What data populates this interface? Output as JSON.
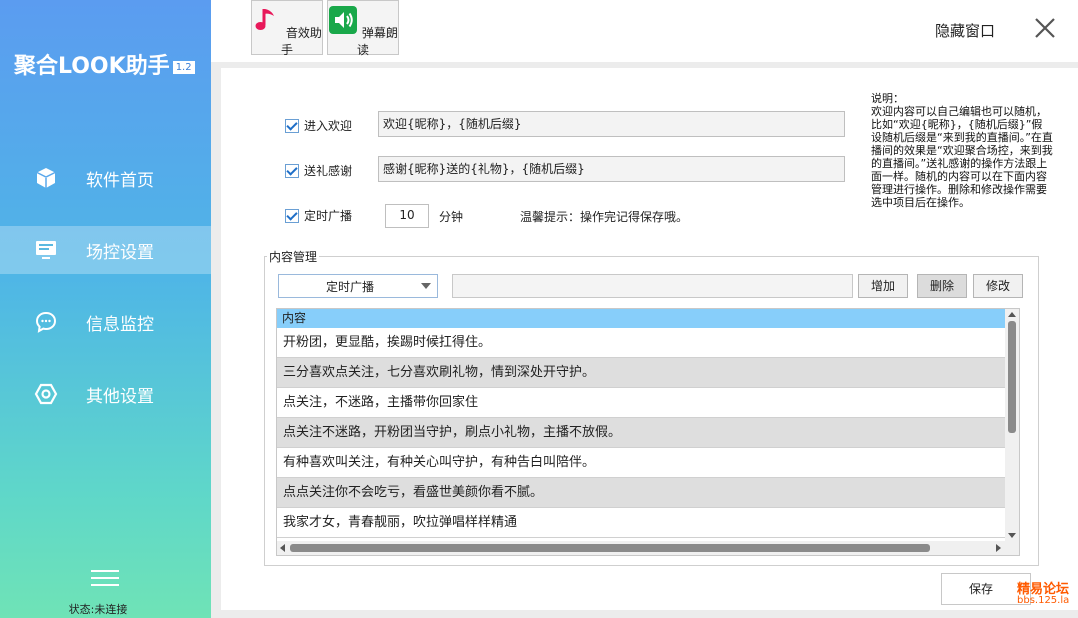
{
  "app": {
    "title": "聚合LOOK助手",
    "version": "1.2"
  },
  "sidebar": {
    "items": [
      {
        "label": "软件首页",
        "icon": "cube-icon",
        "active": false
      },
      {
        "label": "场控设置",
        "icon": "monitor-icon",
        "active": true
      },
      {
        "label": "信息监控",
        "icon": "chat-bubble-icon",
        "active": false
      },
      {
        "label": "其他设置",
        "icon": "hexagon-gear-icon",
        "active": false
      }
    ],
    "status": "状态:未连接"
  },
  "toolbar": {
    "sound_assistant": "音效助手",
    "danmaku_reader": "弹幕朗读",
    "hide_window": "隐藏窗口"
  },
  "settings": {
    "welcome": {
      "label": "进入欢迎",
      "checked": true,
      "value": "欢迎{昵称}，{随机后缀}"
    },
    "gift_thanks": {
      "label": "送礼感谢",
      "checked": true,
      "value": "感谢{昵称}送的{礼物}，{随机后缀}"
    },
    "timed_broadcast": {
      "label": "定时广播",
      "checked": true,
      "minutes": "10",
      "unit": "分钟"
    },
    "tip": "温馨提示：操作完记得保存哦。"
  },
  "help_text": "说明：\n欢迎内容可以自己编辑也可以随机，比如“欢迎{昵称}，{随机后缀}”假设随机后缀是“来到我的直播间。”在直播间的效果是“欢迎聚合场控，来到我的直播间。”送礼感谢的操作方法跟上面一样。随机的内容可以在下面内容管理进行操作。删除和修改操作需要选中项目后在操作。",
  "content_manager": {
    "title": "内容管理",
    "category": "定时广播",
    "input_value": "",
    "add_label": "增加",
    "delete_label": "删除",
    "edit_label": "修改",
    "column_header": "内容",
    "rows": [
      "开粉团，更显酷，挨踢时候扛得住。",
      "三分喜欢点关注，七分喜欢刷礼物，情到深处开守护。",
      "点关注，不迷路，主播带你回家住",
      "点关注不迷路，开粉团当守护，刷点小礼物，主播不放假。",
      "有种喜欢叫关注，有种关心叫守护，有种告白叫陪伴。",
      "点点关注你不会吃亏，看盛世美颜你看不腻。",
      "我家才女，青春靓丽，吹拉弹唱样样精通"
    ]
  },
  "save_label": "保存",
  "watermark": {
    "line1": "精易论坛",
    "line2": "bbs.125.la"
  },
  "colors": {
    "accent": "#87cefa",
    "sidebar_top": "#5b9cf0",
    "sidebar_bottom": "#6fe3b6",
    "watermark": "#ff5a00"
  }
}
